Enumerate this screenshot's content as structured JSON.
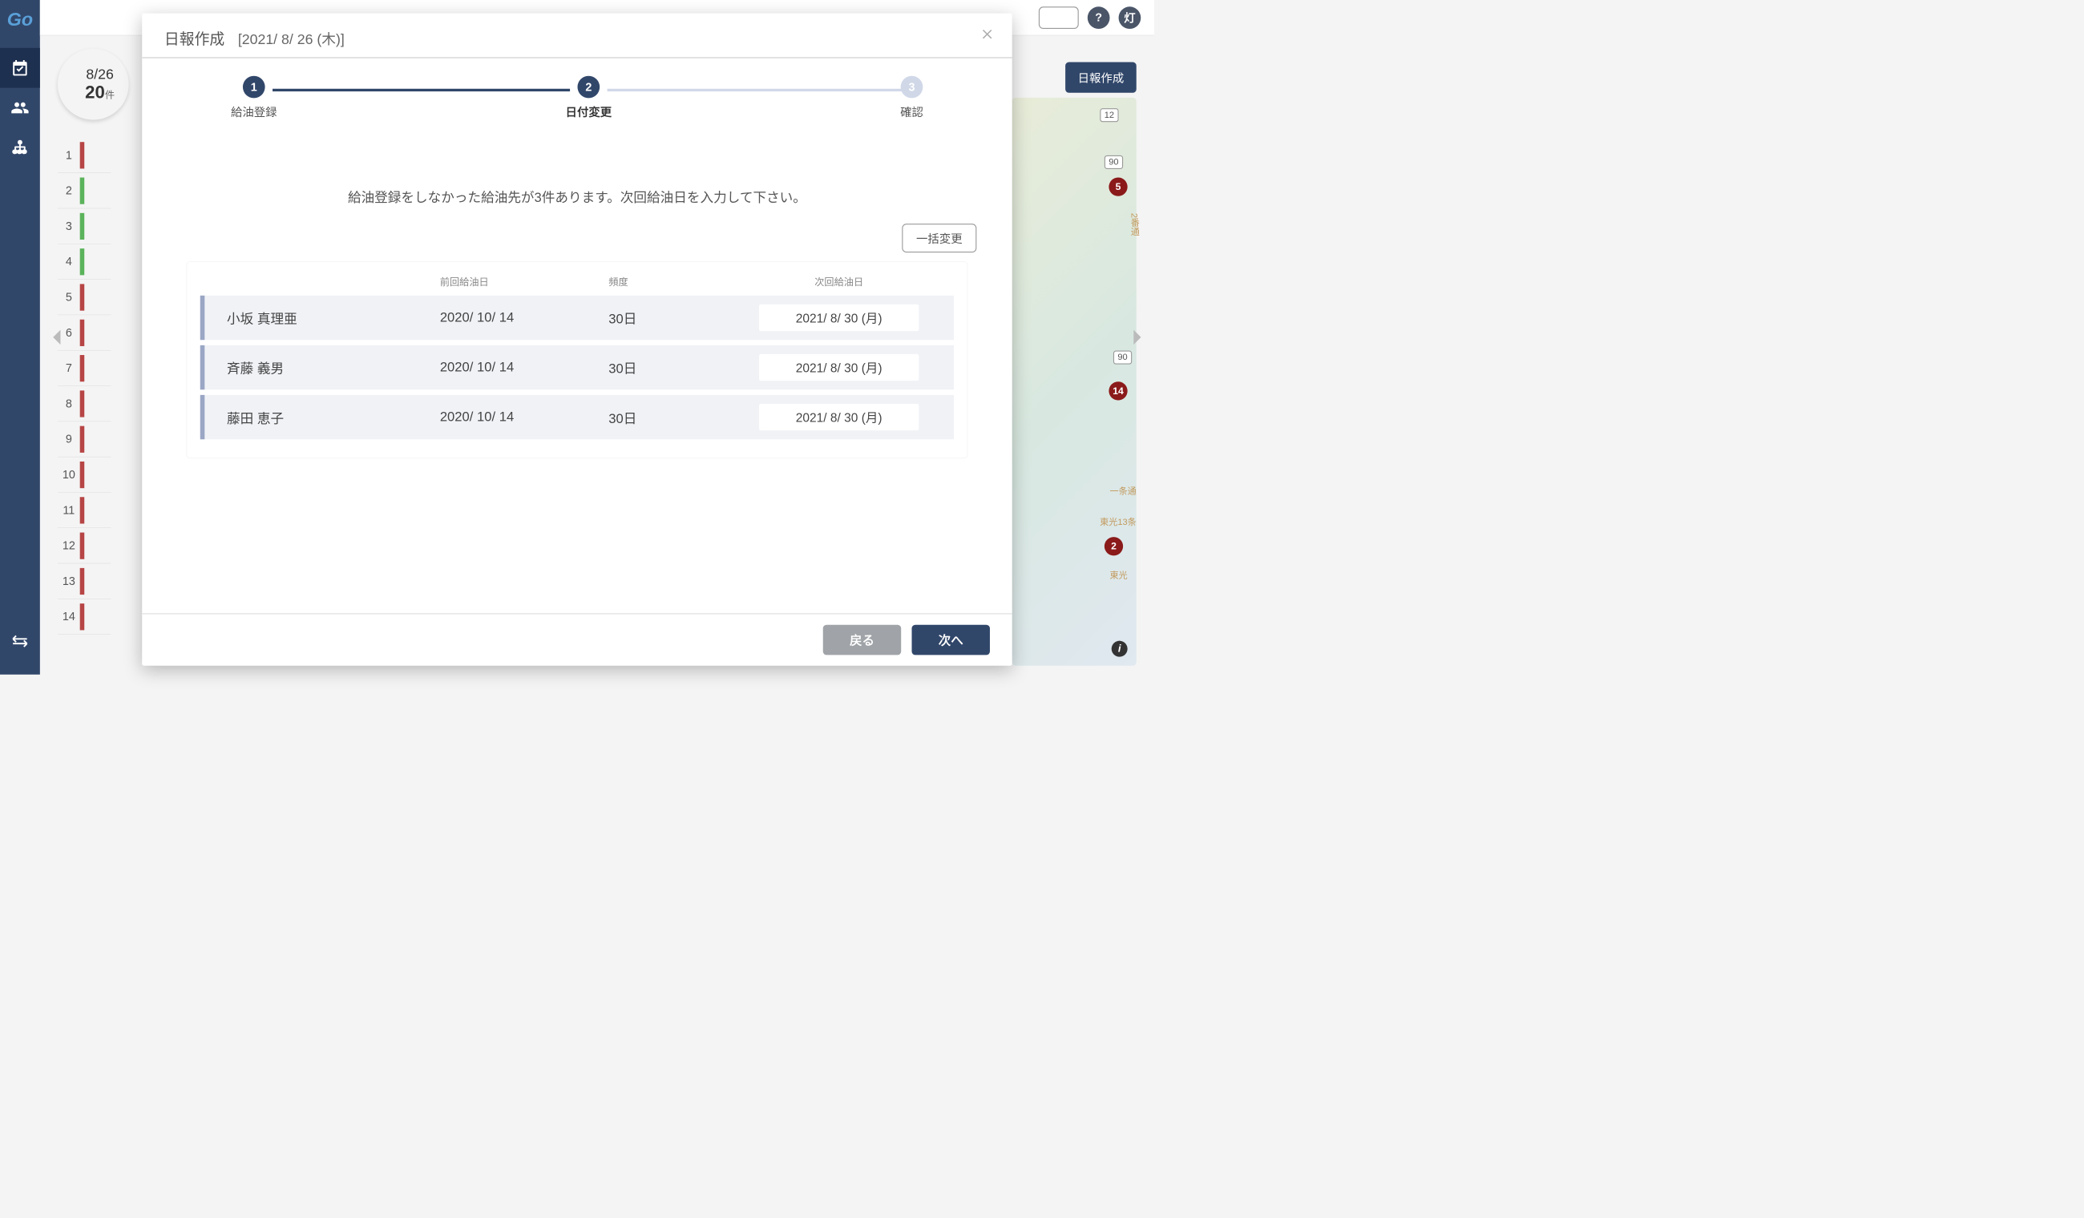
{
  "app": {
    "logo": "Go"
  },
  "topbar": {
    "help": "?",
    "user_badge": "灯"
  },
  "background": {
    "date": "8/26",
    "count": "20",
    "count_unit": "件",
    "create_button": "日報作成",
    "list": [
      {
        "num": "1",
        "color": "red"
      },
      {
        "num": "2",
        "color": "green"
      },
      {
        "num": "3",
        "color": "green"
      },
      {
        "num": "4",
        "color": "green"
      },
      {
        "num": "5",
        "color": "red"
      },
      {
        "num": "6",
        "color": "red"
      },
      {
        "num": "7",
        "color": "red"
      },
      {
        "num": "8",
        "color": "red"
      },
      {
        "num": "9",
        "color": "red"
      },
      {
        "num": "10",
        "color": "red"
      },
      {
        "num": "11",
        "color": "red"
      },
      {
        "num": "12",
        "color": "red"
      },
      {
        "num": "13",
        "color": "red"
      },
      {
        "num": "14",
        "color": "red"
      }
    ],
    "map": {
      "badges": [
        {
          "value": "5"
        },
        {
          "value": "14"
        },
        {
          "value": "2"
        }
      ],
      "routes": [
        "12",
        "90",
        "90"
      ],
      "streets": [
        "2番通",
        "一条通",
        "東光13条",
        "東光"
      ]
    }
  },
  "modal": {
    "title": "日報作成",
    "date": "[2021/ 8/ 26 (木)]",
    "steps": [
      {
        "num": "1",
        "label": "給油登録"
      },
      {
        "num": "2",
        "label": "日付変更"
      },
      {
        "num": "3",
        "label": "確認"
      }
    ],
    "message": "給油登録をしなかった給油先が3件あります。次回給油日を入力して下さい。",
    "bulk_button": "一括変更",
    "table": {
      "headers": {
        "name": "",
        "last_date": "前回給油日",
        "frequency": "頻度",
        "next_date": "次回給油日"
      },
      "rows": [
        {
          "name": "小坂 真理亜",
          "last_date": "2020/ 10/ 14",
          "frequency": "30日",
          "next_date": "2021/  8/ 30 (月)"
        },
        {
          "name": "斉藤 義男",
          "last_date": "2020/ 10/ 14",
          "frequency": "30日",
          "next_date": "2021/  8/ 30 (月)"
        },
        {
          "name": "藤田 恵子",
          "last_date": "2020/ 10/ 14",
          "frequency": "30日",
          "next_date": "2021/  8/ 30 (月)"
        }
      ]
    },
    "footer": {
      "back": "戻る",
      "next": "次へ"
    }
  }
}
